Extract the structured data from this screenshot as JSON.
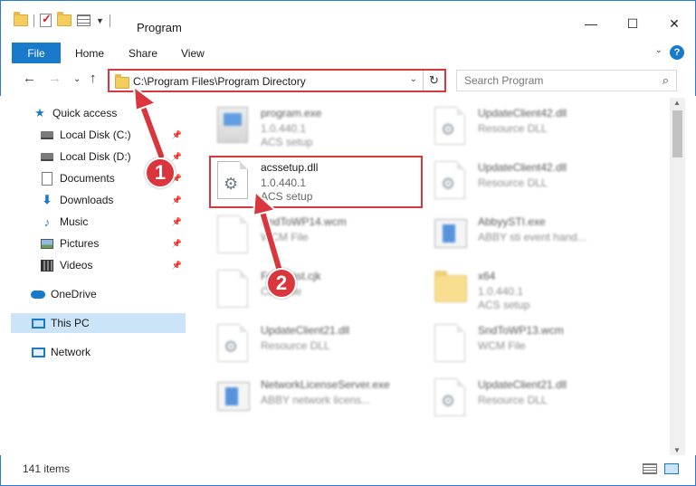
{
  "window": {
    "title": "Program",
    "minimize": "—",
    "maximize": "☐",
    "close": "✕"
  },
  "ribbon": {
    "tabs": [
      "File",
      "Home",
      "Share",
      "View"
    ],
    "help": "?",
    "collapse": "⌄"
  },
  "address": {
    "path": "C:\\Program Files\\Program Directory",
    "dropdown": "⌄",
    "refresh": "↻"
  },
  "search": {
    "placeholder": "Search Program"
  },
  "nav": {
    "back": "←",
    "forward": "→",
    "recent": "⌄",
    "up": "↑",
    "items": [
      {
        "label": "Quick access",
        "icon": "star-icon",
        "pinned": false
      },
      {
        "label": "Local Disk (C:)",
        "icon": "drive-icon",
        "pinned": true
      },
      {
        "label": "Local Disk (D:)",
        "icon": "drive-icon",
        "pinned": true
      },
      {
        "label": "Documents",
        "icon": "documents-icon",
        "pinned": true
      },
      {
        "label": "Downloads",
        "icon": "downloads-icon",
        "pinned": true
      },
      {
        "label": "Music",
        "icon": "music-icon",
        "pinned": true
      },
      {
        "label": "Pictures",
        "icon": "pictures-icon",
        "pinned": true
      },
      {
        "label": "Videos",
        "icon": "videos-icon",
        "pinned": true
      },
      {
        "label": "OneDrive",
        "icon": "onedrive-icon",
        "pinned": false
      },
      {
        "label": "This PC",
        "icon": "this-pc-icon",
        "pinned": false
      },
      {
        "label": "Network",
        "icon": "network-icon",
        "pinned": false
      }
    ],
    "pin_glyph": "📌"
  },
  "files": [
    {
      "name": "program.exe",
      "version": "1.0.440.1",
      "description": "ACS setup",
      "icon": "exe-icon"
    },
    {
      "name": "UpdateClient42.dll",
      "version": "",
      "description": "Resource DLL",
      "icon": "dll-icon"
    },
    {
      "name": "acssetup.dll",
      "version": "1.0.440.1",
      "description": "ACS setup",
      "icon": "dll-icon"
    },
    {
      "name": "UpdateClient42.dll",
      "version": "",
      "description": "Resource DLL",
      "icon": "dll-icon"
    },
    {
      "name": "SndToWP14.wcm",
      "version": "",
      "description": "WCM File",
      "icon": "file-icon"
    },
    {
      "name": "AbbyySTI.exe",
      "version": "",
      "description": "ABBY sti event hand...",
      "icon": "app-icon"
    },
    {
      "name": "FontsList.cjk",
      "version": "",
      "description": "CJK File",
      "icon": "file-icon"
    },
    {
      "name": "x64",
      "version": "1.0.440.1",
      "description": "ACS setup",
      "icon": "folder-icon"
    },
    {
      "name": "UpdateClient21.dll",
      "version": "",
      "description": "Resource DLL",
      "icon": "dll-icon"
    },
    {
      "name": "SndToWP13.wcm",
      "version": "",
      "description": "WCM File",
      "icon": "file-icon"
    },
    {
      "name": "NetworkLicenseServer.exe",
      "version": "",
      "description": "ABBY network licens...",
      "icon": "app-icon"
    },
    {
      "name": "UpdateClient21.dll",
      "version": "",
      "description": "Resource DLL",
      "icon": "dll-icon"
    }
  ],
  "annotations": {
    "step1": "1",
    "step2": "2"
  },
  "status": {
    "item_count": "141 items"
  }
}
